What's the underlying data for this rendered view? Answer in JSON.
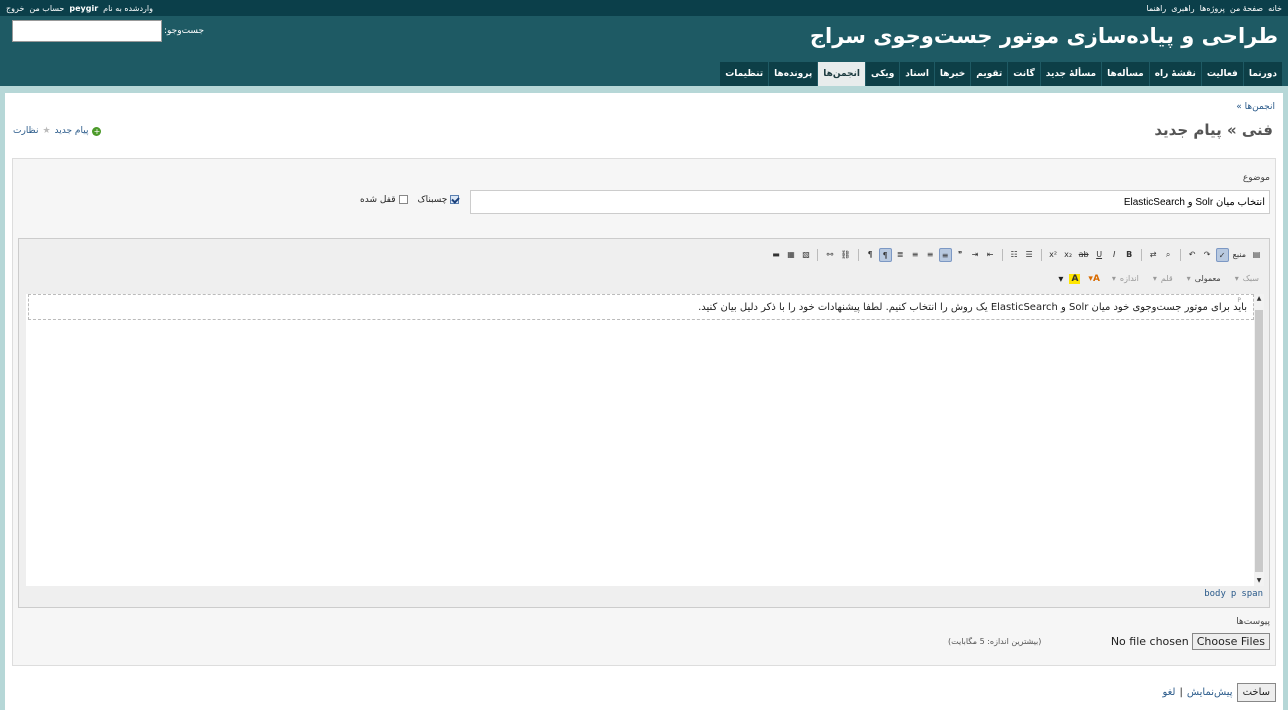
{
  "top_menu": {
    "right_items": [
      "خانه",
      "صفحهٔ من",
      "پروژه‌ها",
      "راهبری",
      "راهنما"
    ],
    "logged_in_prefix": "واردشده به نام",
    "username": "peygir",
    "account": "حساب من",
    "logout": "خروج"
  },
  "header": {
    "project_title": "طراحی و پیاده‌سازی موتور جست‌وجوی سراج",
    "search_label": "جست‌وجو:",
    "search_value": ""
  },
  "main_menu": {
    "tabs": [
      {
        "label": "دورنما",
        "active": false
      },
      {
        "label": "فعالیت",
        "active": false
      },
      {
        "label": "نقشهٔ راه",
        "active": false
      },
      {
        "label": "مسأله‌ها",
        "active": false
      },
      {
        "label": "مسألهٔ جدید",
        "active": false
      },
      {
        "label": "گانت",
        "active": false
      },
      {
        "label": "تقویم",
        "active": false
      },
      {
        "label": "خبرها",
        "active": false
      },
      {
        "label": "اسناد",
        "active": false
      },
      {
        "label": "ویکی",
        "active": false
      },
      {
        "label": "انجمن‌ها",
        "active": true
      },
      {
        "label": "پرونده‌ها",
        "active": false
      },
      {
        "label": "تنظیمات",
        "active": false
      }
    ]
  },
  "breadcrumb": "انجمن‌ها »",
  "page_title": "فنی » پیام جدید",
  "contextual": {
    "new_message": "پیام جدید",
    "watch": "نظارت"
  },
  "form": {
    "subject_label": "موضوع",
    "subject_value": "انتخاب میان Solr و ElasticSearch",
    "sticky_label": "چسبناک",
    "sticky_checked": true,
    "locked_label": "قفل شده",
    "locked_checked": false
  },
  "editor": {
    "source_label": "منبع",
    "format_combo": {
      "label": "سبک",
      "value": "معمولی"
    },
    "font_combo": {
      "label": "قلم"
    },
    "size_combo": {
      "label": "اندازه"
    },
    "content": "باید برای موتور جست‌وجوی خود میان Solr و ElasticSearch یک روش را انتخاب کنیم. لطفا پیشنهادات خود را با ذکر دلیل بیان کنید.",
    "path": [
      "body",
      "p",
      "span"
    ],
    "p_marker": "P"
  },
  "attachments": {
    "label": "پیوست‌ها",
    "choose_button": "Choose Files",
    "no_file": "No file chosen",
    "max_size": "(بیشترین اندازه: 5 مگابایت)"
  },
  "actions": {
    "create": "ساخت",
    "preview": "پیش‌نمایش",
    "separator": "|",
    "cancel": "لغو"
  }
}
